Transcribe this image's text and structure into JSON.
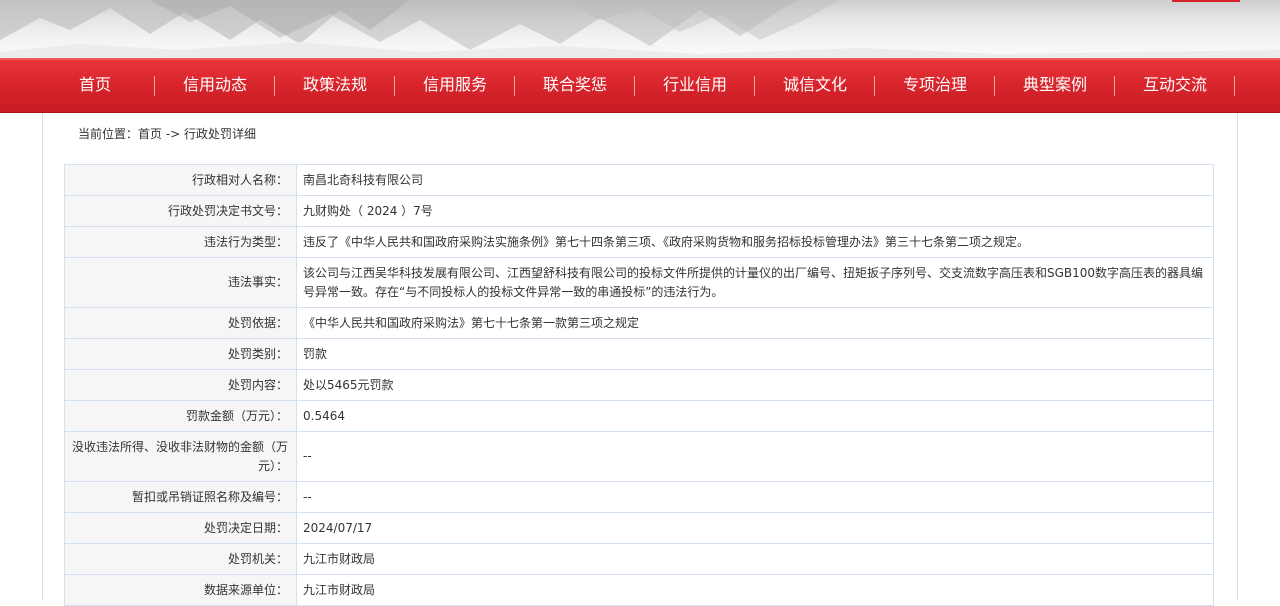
{
  "nav": {
    "items": [
      "首页",
      "信用动态",
      "政策法规",
      "信用服务",
      "联合奖惩",
      "行业信用",
      "诚信文化",
      "专项治理",
      "典型案例",
      "互动交流"
    ]
  },
  "breadcrumb": {
    "prefix": "当前位置：",
    "home": "首页",
    "sep": " -> ",
    "current": "行政处罚详细"
  },
  "detail": {
    "rows": [
      {
        "label": "行政相对人名称：",
        "value": "南昌北奇科技有限公司"
      },
      {
        "label": "行政处罚决定书文号：",
        "value": "九财购处（ 2024 ）7号"
      },
      {
        "label": "违法行为类型：",
        "value": "违反了《中华人民共和国政府采购法实施条例》第七十四条第三项、《政府采购货物和服务招标投标管理办法》第三十七条第二项之规定。"
      },
      {
        "label": "违法事实：",
        "value": "该公司与江西吴华科技发展有限公司、江西望舒科技有限公司的投标文件所提供的计量仪的出厂编号、扭矩扳子序列号、交支流数字高压表和SGB100数字高压表的器具编号异常一致。存在“与不同投标人的投标文件异常一致的串通投标”的违法行为。"
      },
      {
        "label": "处罚依据：",
        "value": "《中华人民共和国政府采购法》第七十七条第一款第三项之规定"
      },
      {
        "label": "处罚类别：",
        "value": "罚款"
      },
      {
        "label": "处罚内容：",
        "value": "处以5465元罚款"
      },
      {
        "label": "罚款金额（万元）：",
        "value": "0.5464"
      },
      {
        "label": "没收违法所得、没收非法财物的金额（万元）：",
        "value": "--"
      },
      {
        "label": "暂扣或吊销证照名称及编号：",
        "value": "--"
      },
      {
        "label": "处罚决定日期：",
        "value": "2024/07/17"
      },
      {
        "label": "处罚机关：",
        "value": "九江市财政局"
      },
      {
        "label": "数据来源单位：",
        "value": "九江市财政局"
      }
    ]
  },
  "colors": {
    "nav_red": "#d9252c",
    "label_bg": "#f6f6f6",
    "border": "#d4e2ef"
  }
}
